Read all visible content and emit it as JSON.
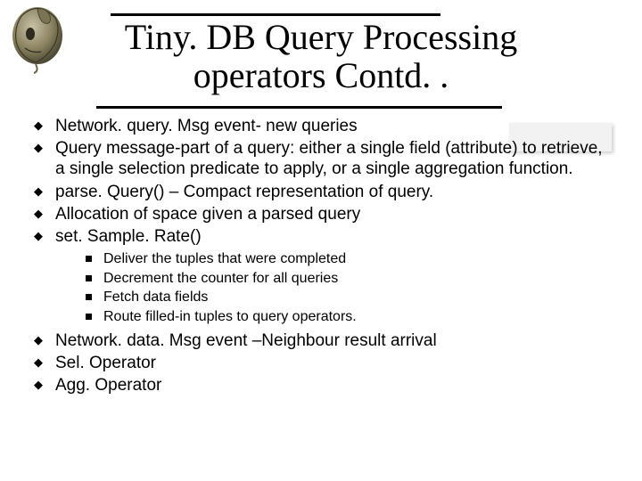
{
  "title_line1": "Tiny. DB Query Processing",
  "title_line2": "operators Contd. .",
  "bullets": {
    "b1": "Network. query. Msg event- new queries",
    "b2": "Query message-part of a query: either a single field (attribute) to retrieve, a single selection predicate to apply, or a single aggregation function.",
    "b3": "parse. Query() – Compact representation of query.",
    "b4": "Allocation of space given a parsed query",
    "b5": "set. Sample. Rate()",
    "b6": "Network. data. Msg event –Neighbour result arrival",
    "b7": "Sel. Operator",
    "b8": "Agg. Operator"
  },
  "sub": {
    "s1": "Deliver the tuples that were completed",
    "s2": "Decrement the counter for all queries",
    "s3": "Fetch data fields",
    "s4": "Route filled-in tuples to query operators."
  }
}
